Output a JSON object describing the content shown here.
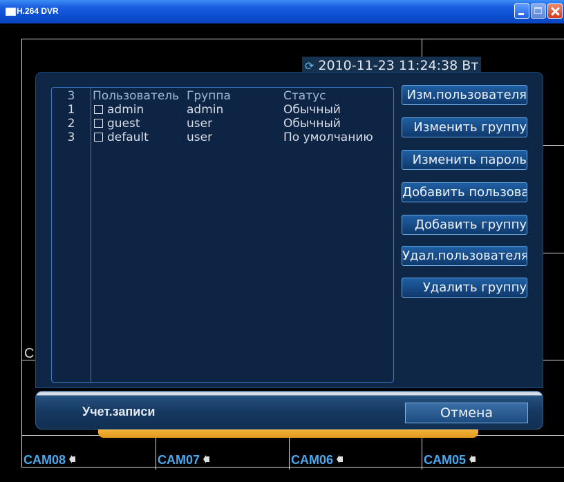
{
  "window": {
    "title": "H.264 DVR"
  },
  "overlay": {
    "datetime": "2010-11-23 11:24:38 Вт",
    "edge_letter": "C"
  },
  "table": {
    "headers": {
      "no": "3",
      "user": "Пользователь",
      "group": "Группа",
      "status": "Статус"
    },
    "rows": [
      {
        "no": "1",
        "user": "admin",
        "group": "admin",
        "status": "Обычный"
      },
      {
        "no": "2",
        "user": "guest",
        "group": "user",
        "status": "Обычный"
      },
      {
        "no": "3",
        "user": "default",
        "group": "user",
        "status": "По умолчанию"
      }
    ]
  },
  "buttons": {
    "modify_user": "Изм.пользователя",
    "modify_group": "Изменить группу",
    "modify_password": "Изменить пароль",
    "add_user": "Добавить пользователя",
    "add_group": "Добавить группу",
    "delete_user": "Удал.пользователя",
    "delete_group": "Удалить группу",
    "cancel": "Отмена"
  },
  "footer": {
    "title": "Учет.записи"
  },
  "cameras": [
    "CAM08",
    "CAM07",
    "CAM06",
    "CAM05"
  ]
}
